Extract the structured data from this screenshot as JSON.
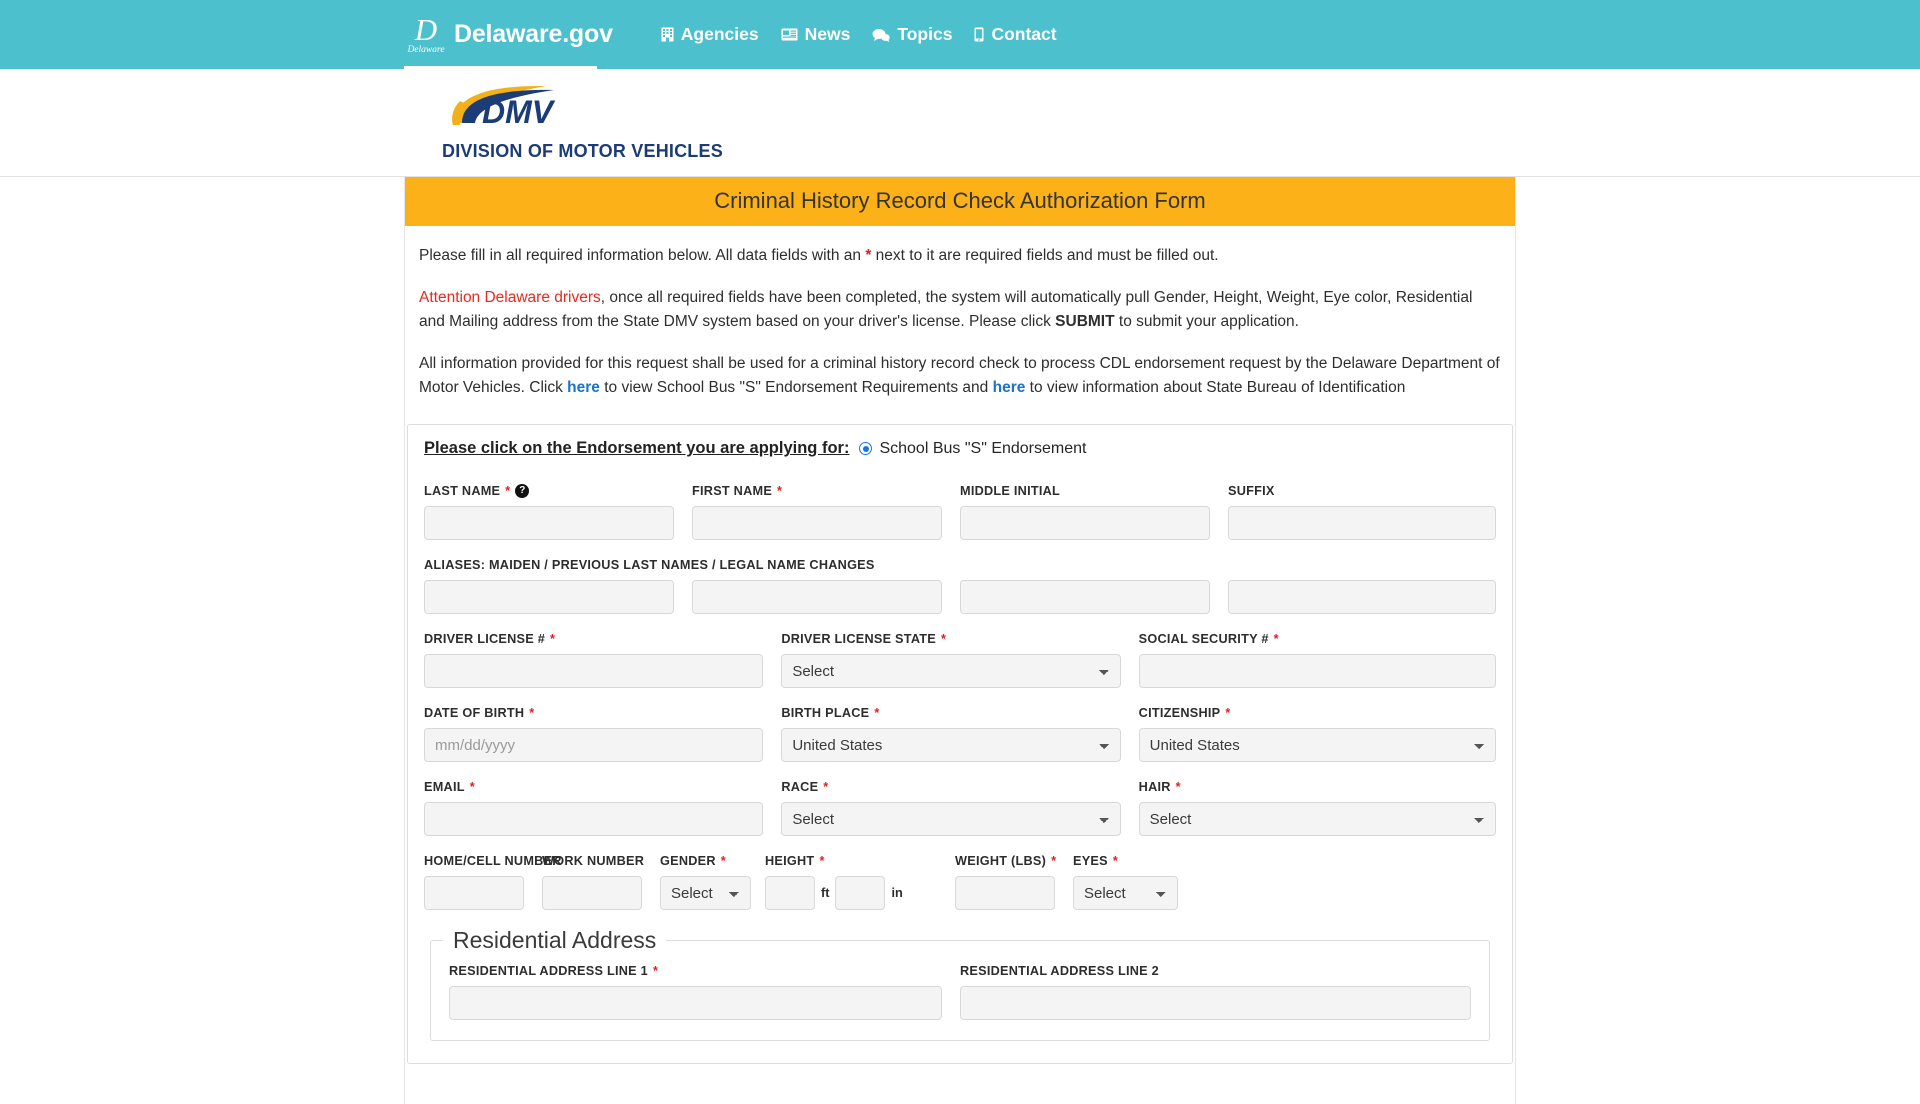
{
  "topbar": {
    "brand": "Delaware.gov",
    "seal_letter": "D",
    "seal_word": "Delaware",
    "nav": [
      {
        "label": "Agencies",
        "icon": "building-icon"
      },
      {
        "label": "News",
        "icon": "newspaper-icon"
      },
      {
        "label": "Topics",
        "icon": "chat-bubbles-icon"
      },
      {
        "label": "Contact",
        "icon": "mobile-phone-icon"
      }
    ]
  },
  "dmv_header": {
    "logo_text": "DMV",
    "subtitle": "DIVISION OF MOTOR VEHICLES"
  },
  "banner": {
    "title": "Criminal History Record Check Authorization Form",
    "background": "#fbb117"
  },
  "intro": {
    "p1_a": "Please fill in all required information below. All data fields with an ",
    "p1_star": "*",
    "p1_b": " next to it are required fields and must be filled out.",
    "p2_attn": "Attention Delaware drivers",
    "p2_a": ", once all required fields have been completed, the system will automatically pull Gender, Height, Weight, Eye color, Residential and Mailing address from the State DMV system based on your driver's license. Please click ",
    "p2_submit": "SUBMIT",
    "p2_b": " to submit your application.",
    "p3_a": "All information provided for this request shall be used for a criminal history record check to process CDL endorsement request by the Delaware Department of Motor Vehicles. Click ",
    "p3_link1": "here",
    "p3_b": " to view School Bus \"S\" Endorsement Requirements and ",
    "p3_link2": "here",
    "p3_c": " to view information about State Bureau of Identification"
  },
  "form": {
    "endorsement_label": "Please click on the Endorsement you are applying for:",
    "endorsement_option": "School Bus \"S\" Endorsement",
    "endorsement_checked": true,
    "labels": {
      "last_name": "LAST NAME",
      "first_name": "FIRST NAME",
      "middle_initial": "MIDDLE INITIAL",
      "suffix": "SUFFIX",
      "aliases": "ALIASES: MAIDEN / PREVIOUS LAST NAMES / LEGAL NAME CHANGES",
      "driver_license": "DRIVER LICENSE #",
      "driver_license_state": "DRIVER LICENSE STATE",
      "social_security": "SOCIAL SECURITY #",
      "date_of_birth": "DATE OF BIRTH",
      "birth_place": "BIRTH PLACE",
      "citizenship": "CITIZENSHIP",
      "email": "EMAIL",
      "race": "RACE",
      "hair": "HAIR",
      "home_cell_number": "HOME/CELL NUMBER",
      "work_number": "WORK NUMBER",
      "gender": "GENDER",
      "height": "HEIGHT",
      "weight": "WEIGHT (LBS)",
      "eyes": "EYES"
    },
    "required_marker": "*",
    "help_glyph": "?",
    "values": {
      "last_name": "",
      "first_name": "",
      "middle_initial": "",
      "suffix": "",
      "alias1": "",
      "alias2": "",
      "alias3": "",
      "alias4": "",
      "driver_license": "",
      "driver_license_state": "Select",
      "social_security": "",
      "date_of_birth": "",
      "birth_place": "United States",
      "citizenship": "United States",
      "email": "",
      "race": "Select",
      "hair": "Select",
      "home_cell_number": "",
      "work_number": "",
      "gender": "Select",
      "height_ft": "",
      "height_in": "",
      "weight": "",
      "eyes": "Select"
    },
    "placeholders": {
      "date_of_birth": "mm/dd/yyyy"
    },
    "units": {
      "feet": "ft",
      "inches": "in"
    },
    "select_options": {
      "driver_license_state": [
        "Select"
      ],
      "birth_place": [
        "United States"
      ],
      "citizenship": [
        "United States"
      ],
      "race": [
        "Select"
      ],
      "hair": [
        "Select"
      ],
      "gender": [
        "Select"
      ],
      "eyes": [
        "Select"
      ]
    }
  },
  "residential": {
    "legend": "Residential Address",
    "line1_label": "RESIDENTIAL ADDRESS LINE 1",
    "line2_label": "RESIDENTIAL ADDRESS LINE 2",
    "line1_value": "",
    "line2_value": ""
  }
}
